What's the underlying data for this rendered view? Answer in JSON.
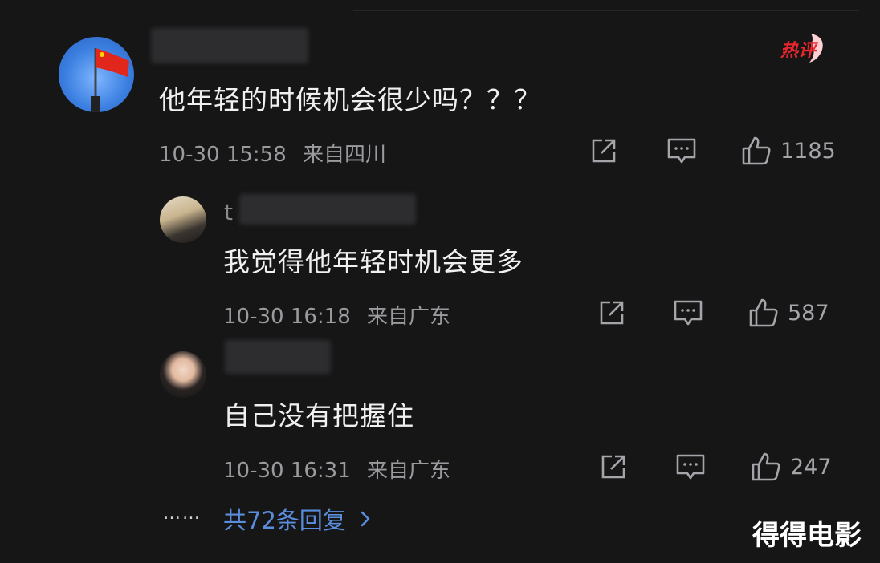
{
  "comments": [
    {
      "text": "他年轻的时候机会很少吗？？？",
      "date": "10-30 15:58",
      "location": "来自四川",
      "likes": "1185",
      "badge": "热评"
    },
    {
      "username_visible": "t",
      "text": "我觉得他年轻时机会更多",
      "date": "10-30 16:18",
      "location": "来自广东",
      "likes": "587"
    },
    {
      "text": "自己没有把握住",
      "date": "10-30 16:31",
      "location": "来自广东",
      "likes": "247"
    }
  ],
  "footer": {
    "ellipsis": "……",
    "replies_label": "共72条回复",
    "watermark": "得得电影"
  },
  "icons": [
    "share-icon",
    "comment-icon",
    "like-icon",
    "chevron-right-icon",
    "hot-comment-badge"
  ],
  "colors": {
    "background": "#161617",
    "link": "#5b8ddd",
    "badge_red": "#e8262d"
  }
}
